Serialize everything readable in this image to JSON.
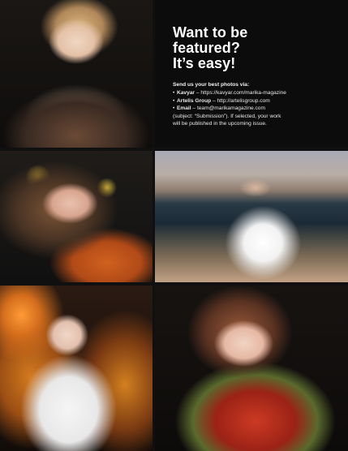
{
  "panel": {
    "headline": "Want to be\nfeatured?\nIt’s easy!",
    "send_label": "Send us your best photos via:",
    "items": [
      {
        "bullet": "•",
        "label": "Kavyar",
        "dash": " – ",
        "value": "https://kavyar.com/marika-magazine"
      },
      {
        "bullet": "•",
        "label": "Artelis Group",
        "dash": " – ",
        "value": "http://artelisgroup.com"
      },
      {
        "bullet": "•",
        "label": "Email",
        "dash": " – ",
        "value": "team@marikamagazine.com"
      }
    ],
    "note_lines": [
      "(subject: “Submission”). If selected, your work",
      "will be published in the upcoming issue."
    ]
  },
  "photos": [
    {
      "name": "photo-child-portrait"
    },
    {
      "name": "photo-girl-with-yellow-flowers"
    },
    {
      "name": "photo-girl-on-beach"
    },
    {
      "name": "photo-girl-among-marigolds"
    },
    {
      "name": "photo-girl-with-flower-bouquet"
    }
  ]
}
